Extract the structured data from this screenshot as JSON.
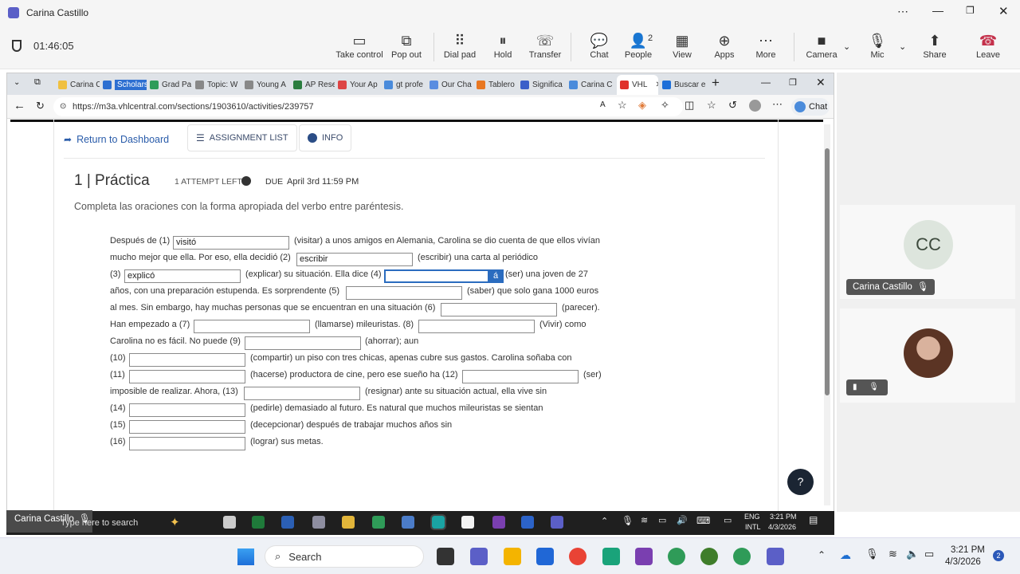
{
  "teams": {
    "window_title": "Carina Castillo",
    "timer": "01:46:05",
    "controls": [
      {
        "label": "Take control",
        "icon": "take-control-icon",
        "glyph": "▭"
      },
      {
        "label": "Pop out",
        "icon": "pop-out-icon",
        "glyph": "⧉"
      },
      {
        "label": "Dial pad",
        "icon": "dial-pad-icon",
        "glyph": "⠿"
      },
      {
        "label": "Hold",
        "icon": "hold-icon",
        "glyph": "⏸"
      },
      {
        "label": "Transfer",
        "icon": "transfer-icon",
        "glyph": "☏"
      },
      {
        "label": "Chat",
        "icon": "chat-icon",
        "glyph": "💬"
      },
      {
        "label": "People",
        "icon": "people-icon",
        "glyph": "👤"
      },
      {
        "label": "View",
        "icon": "view-icon",
        "glyph": "▦"
      },
      {
        "label": "Apps",
        "icon": "apps-icon",
        "glyph": "⊕"
      },
      {
        "label": "More",
        "icon": "more-icon",
        "glyph": "⋯"
      },
      {
        "label": "Camera",
        "icon": "camera-off-icon",
        "glyph": "■"
      },
      {
        "label": "Mic",
        "icon": "mic-off-icon",
        "glyph": "🎙"
      },
      {
        "label": "Share",
        "icon": "share-icon",
        "glyph": "⬆"
      },
      {
        "label": "Leave",
        "icon": "leave-icon",
        "glyph": "☎"
      }
    ],
    "people_count": "2",
    "participants": [
      {
        "initials": "CC",
        "name": "Carina Castillo"
      }
    ]
  },
  "browser": {
    "tabs": [
      "Carina C",
      "Scholarsh",
      "Grad Pa",
      "Topic: W",
      "Young A",
      "AP Rese",
      "Your Ap",
      "gt profe",
      "Our Cha",
      "Tablero",
      "Significa",
      "Carina C",
      "VHL",
      "Buscar e"
    ],
    "url": "https://m3a.vhlcentral.com/sections/1903610/activities/239757",
    "chat_label": "Chat"
  },
  "page": {
    "return_label": "Return to Dashboard",
    "assignment_list_label": "ASSIGNMENT LIST",
    "info_label": "INFO",
    "title": "1 | Práctica",
    "attempts": "1 ATTEMPT LEFT",
    "due_label": "DUE",
    "due_date": "April 3rd 11:59 PM",
    "instructions": "Completa las oraciones con la forma apropiada del verbo entre paréntesis.",
    "accent_button": "á"
  },
  "exercise_texts": [
    "Después de (1)",
    "(visitar) a unos amigos en Alemania, Carolina se dio cuenta de que ellos vivían",
    "mucho mejor que ella. Por eso, ella decidió (2)",
    "(escribir) una carta al periódico",
    "(3)",
    "(explicar) su situación. Ella dice (4)",
    "(ser) una joven de 27",
    "años, con una preparación estupenda. Es sorprendente (5)",
    "(saber) que solo gana 1000 euros",
    "al mes. Sin embargo, hay muchas personas que se encuentran en una situación (6)",
    "(parecer).",
    "Han empezado a (7)",
    "(llamarse) mileuristas. (8)",
    "(Vivir) como",
    "Carolina no es fácil. No puede (9)",
    "(ahorrar); aun",
    "(10)",
    "(compartir) un piso con tres chicas, apenas cubre sus gastos. Carolina soñaba con",
    "(11)",
    "(hacerse) productora de cine, pero ese sueño ha (12)",
    "(ser)",
    "imposible de realizar. Ahora, (13)",
    "(resignar) ante su situación actual, ella vive sin",
    "(14)",
    "(pedirle) demasiado al futuro. Es natural que muchos mileuristas se sientan",
    "(15)",
    "(decepcionar) después de trabajar muchos años sin",
    "(16)",
    "(lograr) sus metas."
  ],
  "answers": [
    "visitó",
    "escribir",
    "explicó",
    "",
    "",
    "",
    "",
    "",
    "",
    "",
    "",
    "",
    "",
    "",
    "",
    ""
  ],
  "inner_taskbar": {
    "self_view_name": "Carina Castillo",
    "search_placeholder": "Type here to search",
    "lang": "ENG",
    "layout": "INTL",
    "time": "3:21 PM",
    "date": "4/3/2026",
    "notification_count": "2"
  },
  "taskbar": {
    "search_label": "Search",
    "time": "3:21 PM",
    "date": "4/3/2026",
    "notification_count": "2"
  },
  "colors": {
    "accent": "#2b6cbf",
    "leave_red": "#c4314b",
    "teams_purple": "#5b5fc7"
  }
}
